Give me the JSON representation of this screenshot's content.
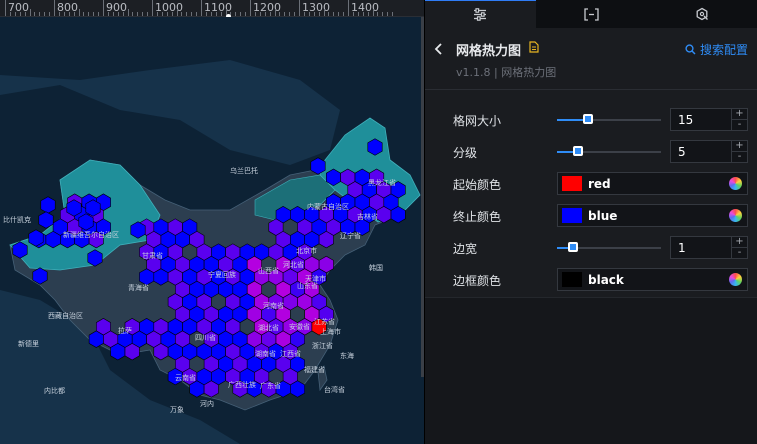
{
  "ruler": {
    "ticks": [
      "700",
      "800",
      "900",
      "1000",
      "1100",
      "1200",
      "1300",
      "1400"
    ]
  },
  "map": {
    "region_labels": [
      "乌兰巴托",
      "内蒙古自治区",
      "黑龙江省",
      "吉林省",
      "辽宁省",
      "新疆维吾尔自治区",
      "比什凯克",
      "甘肃省",
      "青海省",
      "宁夏回族",
      "山西省",
      "河北省",
      "北京市",
      "天津市",
      "韩国",
      "山东省",
      "河南省",
      "西藏自治区",
      "四川省",
      "湖北省",
      "安徽省",
      "江苏省",
      "上海市",
      "新德里",
      "浙江省",
      "湖南省",
      "江西省",
      "福建省",
      "云南省",
      "广西壮族",
      "广东省",
      "台湾省",
      "东海",
      "拉萨",
      "内比都",
      "万象",
      "河内"
    ],
    "hex_start_color": "#ff0000",
    "hex_end_color": "#0000ff",
    "land_color": "#2c3e50",
    "highlight_color": "#1f8f9a"
  },
  "tabs": [
    {
      "icon": "sliders-icon"
    },
    {
      "icon": "bracket-icon"
    },
    {
      "icon": "refresh-icon"
    }
  ],
  "header": {
    "title": "网格热力图",
    "search_label": "搜索配置",
    "version": "v1.1.8 | 网格热力图"
  },
  "props": {
    "grid_size": {
      "label": "格网大小",
      "value": "15",
      "slider_pct": 0.3,
      "plus": "+",
      "minus": "-"
    },
    "levels": {
      "label": "分级",
      "value": "5",
      "slider_pct": 0.2,
      "plus": "+",
      "minus": "-"
    },
    "start_color": {
      "label": "起始颜色",
      "color_name": "red",
      "swatch": "#ff0000"
    },
    "end_color": {
      "label": "终止颜色",
      "color_name": "blue",
      "swatch": "#0000ff"
    },
    "border_width": {
      "label": "边宽",
      "value": "1",
      "slider_pct": 0.15,
      "plus": "+",
      "minus": "-"
    },
    "border_color": {
      "label": "边框颜色",
      "color_name": "black",
      "swatch": "#000000"
    }
  },
  "colors": {
    "accent": "#2f8cf6"
  }
}
